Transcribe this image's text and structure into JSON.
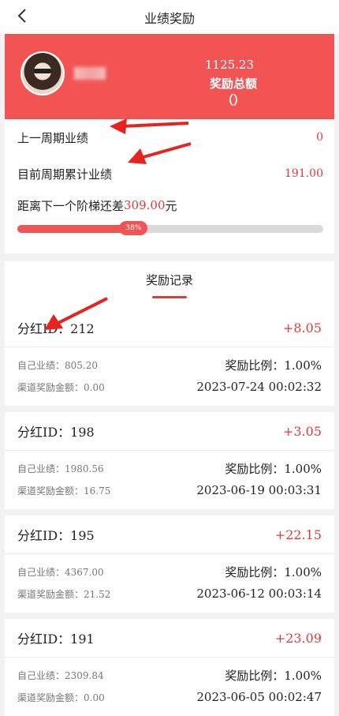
{
  "header": {
    "title": "业绩奖励"
  },
  "hero": {
    "total_amount": "1125.23",
    "total_label": "奖励总额（）"
  },
  "stats": {
    "last_period_label": "上一周期业绩",
    "last_period_value": "0",
    "current_period_label": "目前周期累计业绩",
    "current_period_value": "191.00",
    "ladder_prefix": "距离下一个阶梯还差",
    "ladder_amount": "309.00",
    "ladder_suffix": "元",
    "progress_label": "38%",
    "progress_fraction": 0.38
  },
  "records": {
    "title": "奖励记录",
    "labels": {
      "id_prefix": "分红ID：",
      "own_perf": "自己业绩：",
      "channel_reward": "渠道奖励金额：",
      "ratio": "奖励比例："
    },
    "items": [
      {
        "id": "212",
        "amount": "+8.05",
        "own_perf": "805.20",
        "channel_reward": "0.00",
        "ratio": "1.00%",
        "time": "2023-07-24 00:02:32"
      },
      {
        "id": "198",
        "amount": "+3.05",
        "own_perf": "1980.56",
        "channel_reward": "16.75",
        "ratio": "1.00%",
        "time": "2023-06-19 00:03:31"
      },
      {
        "id": "195",
        "amount": "+22.15",
        "own_perf": "4367.00",
        "channel_reward": "21.52",
        "ratio": "1.00%",
        "time": "2023-06-12 00:03:14"
      },
      {
        "id": "191",
        "amount": "+23.09",
        "own_perf": "2309.84",
        "channel_reward": "0.00",
        "ratio": "1.00%",
        "time": "2023-06-05 00:02:47"
      }
    ]
  },
  "colors": {
    "accent": "#f25454",
    "value_red": "#e53935",
    "background": "#f2f2f2"
  }
}
